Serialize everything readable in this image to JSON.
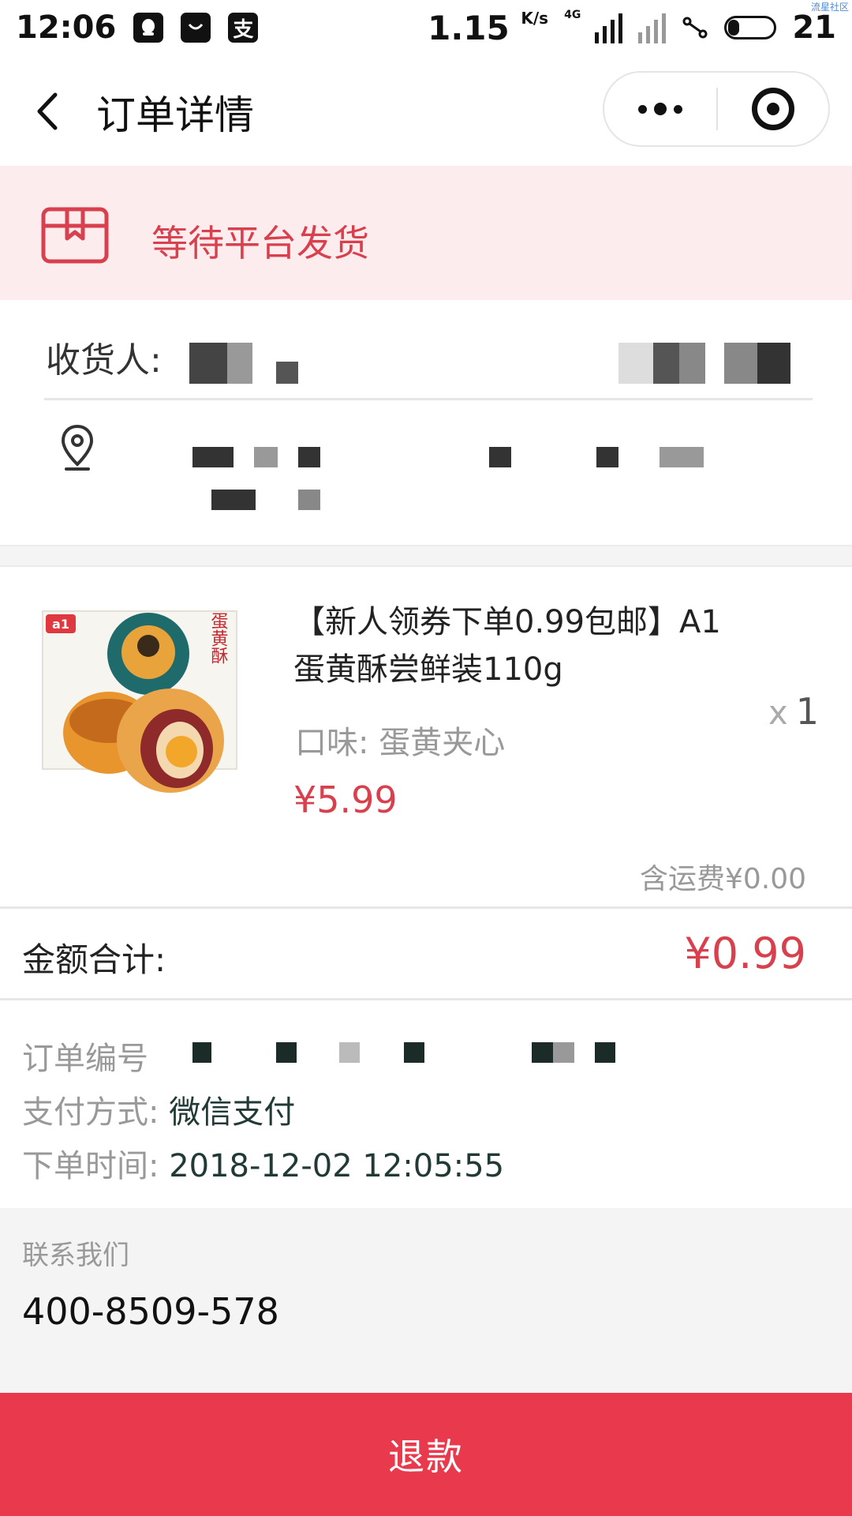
{
  "status_bar": {
    "time": "12:06",
    "net_speed": "1.15",
    "net_unit": "K/s",
    "network_tag": "4G",
    "battery": "21",
    "corner_mark": "流星社区"
  },
  "nav": {
    "title": "订单详情"
  },
  "order_status": {
    "text": "等待平台发货",
    "accent_color": "#d8404e",
    "background": "#fdecee"
  },
  "address": {
    "receiver_label": "收货人:"
  },
  "product": {
    "title": "【新人领券下单0.99包邮】A1蛋黄酥尝鲜装110g",
    "option": "口味: 蛋黄夹心",
    "price": "¥5.99",
    "qty_prefix": "x",
    "quantity": "1",
    "shipping": "含运费¥0.00",
    "image": {
      "brand": "a1",
      "box_text": "蛋黄酥"
    }
  },
  "total": {
    "label": "金额合计:",
    "value": "¥0.99"
  },
  "order_info": {
    "order_no_label": "订单编号",
    "pay_label": "支付方式:",
    "pay_value": "微信支付",
    "time_label": "下单时间:",
    "time_value": "2018-12-02 12:05:55"
  },
  "contact": {
    "title": "联系我们",
    "phone": "400-8509-578"
  },
  "actions": {
    "refund_label": "退款",
    "button_color": "#e8394d"
  }
}
